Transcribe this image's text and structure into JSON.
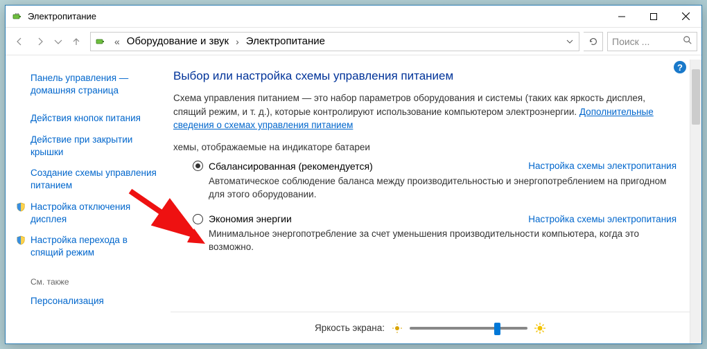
{
  "titlebar": {
    "title": "Электропитание"
  },
  "breadcrumb": {
    "part1": "Оборудование и звук",
    "part2": "Электропитание"
  },
  "search": {
    "placeholder": "Поиск ..."
  },
  "sidebar": {
    "home": "Панель управления — домашняя страница",
    "links": [
      "Действия кнопок питания",
      "Действие при закрытии крышки",
      "Создание схемы управления питанием",
      "Настройка отключения дисплея",
      "Настройка перехода в спящий режим"
    ],
    "see_also_label": "См. также",
    "see_also": "Персонализация"
  },
  "main": {
    "heading": "Выбор или настройка схемы управления питанием",
    "description": "Схема управления питанием — это набор параметров оборудования и системы (таких как яркость дисплея, спящий режим, и т. д.), которые контролируют использование компьютером электроэнергии. ",
    "description_link": "Дополнительные сведения о схемах управления питанием",
    "group_label": "хемы, отображаемые на индикаторе батареи",
    "plan_settings_link": "Настройка схемы электропитания",
    "plans": [
      {
        "name": "Сбалансированная (рекомендуется)",
        "desc": "Автоматическое соблюдение баланса между производительностью и энергопотреблением на пригодном для этого оборудовании.",
        "checked": true
      },
      {
        "name": "Экономия энергии",
        "desc": "Минимальное энергопотребление за счет уменьшения производительности компьютера, когда это возможно.",
        "checked": false
      }
    ],
    "brightness_label": "Яркость экрана:"
  }
}
